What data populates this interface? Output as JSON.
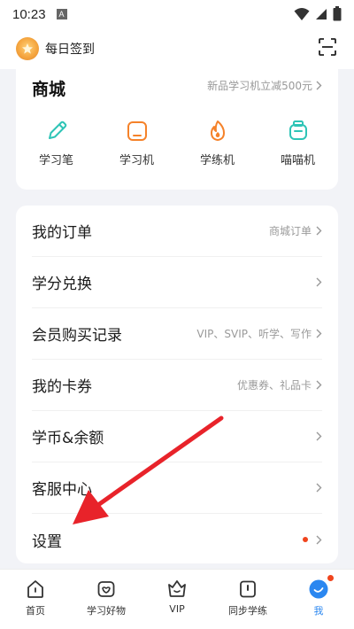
{
  "status_bar": {
    "time": "10:23",
    "indicator": "A"
  },
  "header": {
    "checkin_label": "每日签到",
    "scan_icon": "scan-icon"
  },
  "mall": {
    "title": "商城",
    "promo": "新品学习机立减500元",
    "items": [
      {
        "label": "学习笔",
        "icon": "pen-icon",
        "color": "#2ec4b6"
      },
      {
        "label": "学习机",
        "icon": "tablet-icon",
        "color": "#f5822a"
      },
      {
        "label": "学练机",
        "icon": "flame-icon",
        "color": "#f5822a"
      },
      {
        "label": "喵喵机",
        "icon": "printer-icon",
        "color": "#2ec4b6"
      }
    ]
  },
  "menu": [
    {
      "label": "我的订单",
      "hint": "商城订单"
    },
    {
      "label": "学分兑换",
      "hint": ""
    },
    {
      "label": "会员购买记录",
      "hint": "VIP、SVIP、听学、写作"
    },
    {
      "label": "我的卡券",
      "hint": "优惠券、礼品卡"
    },
    {
      "label": "学币&余额",
      "hint": ""
    },
    {
      "label": "客服中心",
      "hint": ""
    },
    {
      "label": "设置",
      "hint": "",
      "dot": true
    }
  ],
  "tabs": [
    {
      "label": "首页",
      "icon": "home-icon"
    },
    {
      "label": "学习好物",
      "icon": "shop-bag-icon"
    },
    {
      "label": "VIP",
      "icon": "vip-crown-icon"
    },
    {
      "label": "同步学练",
      "icon": "book-icon"
    },
    {
      "label": "我",
      "icon": "me-icon",
      "active": true
    }
  ],
  "colors": {
    "accent": "#2b87f0",
    "badge": "#f0441d",
    "arrow": "#e8232a"
  }
}
